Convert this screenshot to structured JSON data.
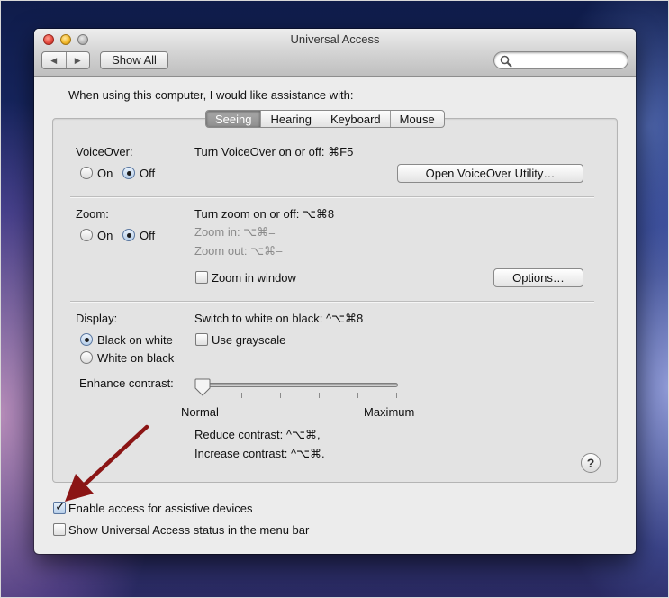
{
  "window": {
    "title": "Universal Access",
    "show_all_label": "Show All",
    "nav_back_glyph": "◀",
    "nav_forward_glyph": "▶",
    "search_placeholder": ""
  },
  "intro_text": "When using this computer, I would like assistance with:",
  "tabs": [
    {
      "label": "Seeing",
      "active": true
    },
    {
      "label": "Hearing",
      "active": false
    },
    {
      "label": "Keyboard",
      "active": false
    },
    {
      "label": "Mouse",
      "active": false
    }
  ],
  "voiceover": {
    "label": "VoiceOver:",
    "on_label": "On",
    "off_label": "Off",
    "selected": "Off",
    "shortcut_text": "Turn VoiceOver on or off: ⌘F5",
    "utility_button": "Open VoiceOver Utility…"
  },
  "zoom": {
    "label": "Zoom:",
    "on_label": "On",
    "off_label": "Off",
    "selected": "Off",
    "shortcut_text": "Turn zoom on or off: ⌥⌘8",
    "zoom_in_text": "Zoom in: ⌥⌘=",
    "zoom_out_text": "Zoom out: ⌥⌘–",
    "window_checkbox_label": "Zoom in window",
    "window_checkbox_checked": false,
    "options_button": "Options…"
  },
  "display": {
    "label": "Display:",
    "black_on_white_label": "Black on white",
    "white_on_black_label": "White on black",
    "selected": "Black on white",
    "switch_text": "Switch to white on black: ^⌥⌘8",
    "grayscale_label": "Use grayscale",
    "grayscale_checked": false,
    "contrast_label": "Enhance contrast:",
    "contrast_min_label": "Normal",
    "contrast_max_label": "Maximum",
    "contrast_value": 0,
    "reduce_text": "Reduce contrast: ^⌥⌘,",
    "increase_text": "Increase contrast: ^⌥⌘."
  },
  "help_label": "?",
  "bottom": {
    "assistive_label": "Enable access for assistive devices",
    "assistive_checked": true,
    "status_label": "Show Universal Access status in the menu bar",
    "status_checked": false
  },
  "annotation": {
    "arrow_color": "#8b1515"
  }
}
